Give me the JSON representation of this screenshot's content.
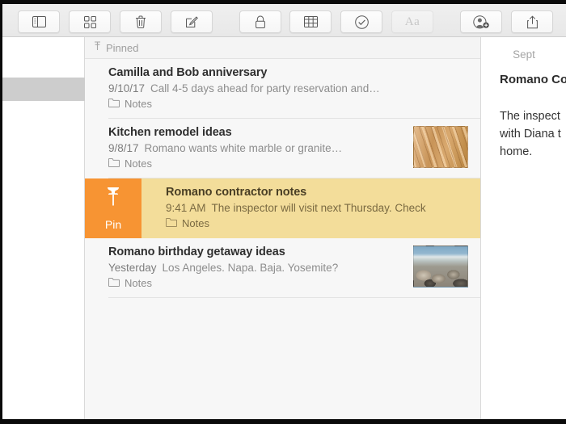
{
  "toolbar": {
    "buttons": [
      {
        "name": "sidebar-toggle-button",
        "icon": "sidebar-icon",
        "label": "",
        "disabled": false
      },
      {
        "name": "gallery-view-button",
        "icon": "grid-icon",
        "label": "",
        "disabled": false
      },
      {
        "name": "delete-note-button",
        "icon": "trash-icon",
        "label": "",
        "disabled": false
      },
      {
        "name": "compose-note-button",
        "icon": "compose-icon",
        "label": "",
        "disabled": false
      },
      {
        "name": "lock-note-button",
        "icon": "lock-icon",
        "label": "",
        "disabled": false
      },
      {
        "name": "insert-table-button",
        "icon": "table-icon",
        "label": "",
        "disabled": false
      },
      {
        "name": "checklist-button",
        "icon": "check-circle-icon",
        "label": "",
        "disabled": false
      },
      {
        "name": "format-button",
        "icon": "text-format-icon",
        "label": "Aa",
        "disabled": true
      },
      {
        "name": "add-collaborator-button",
        "icon": "add-person-icon",
        "label": "",
        "disabled": false
      },
      {
        "name": "share-button",
        "icon": "share-icon",
        "label": "",
        "disabled": false
      }
    ]
  },
  "notelist": {
    "section_header": "Pinned",
    "section_icon": "pin-icon",
    "folder_icon": "folder-icon",
    "folder_label": "Notes",
    "notes": [
      {
        "title": "Camilla and Bob anniversary",
        "date": "9/10/17",
        "snippet": "Call 4-5 days ahead for party reservation and…",
        "folder": "Notes",
        "thumbnail": "none",
        "swiped": false
      },
      {
        "title": "Kitchen remodel ideas",
        "date": "9/8/17",
        "snippet": "Romano wants white marble or granite…",
        "folder": "Notes",
        "thumbnail": "wood",
        "swiped": false
      },
      {
        "title": "Romano contractor notes",
        "date": "9:41 AM",
        "snippet": "The inspector will visit next Thursday. Check",
        "folder": "Notes",
        "thumbnail": "none",
        "swiped": true,
        "action_label": "Pin",
        "action_icon": "pin-icon"
      },
      {
        "title": "Romano birthday getaway ideas",
        "date": "Yesterday",
        "snippet": "Los Angeles. Napa. Baja. Yosemite?",
        "folder": "Notes",
        "thumbnail": "beach",
        "swiped": false
      }
    ]
  },
  "detail": {
    "date": "Sept",
    "title": "Romano Co",
    "body": "The inspect\nwith Diana t\nhome."
  },
  "colors": {
    "pin_action": "#F79433",
    "row_highlight": "#F3DD9A",
    "sidebar_selection": "#CDCDCD",
    "list_background": "#F7F7F7"
  }
}
